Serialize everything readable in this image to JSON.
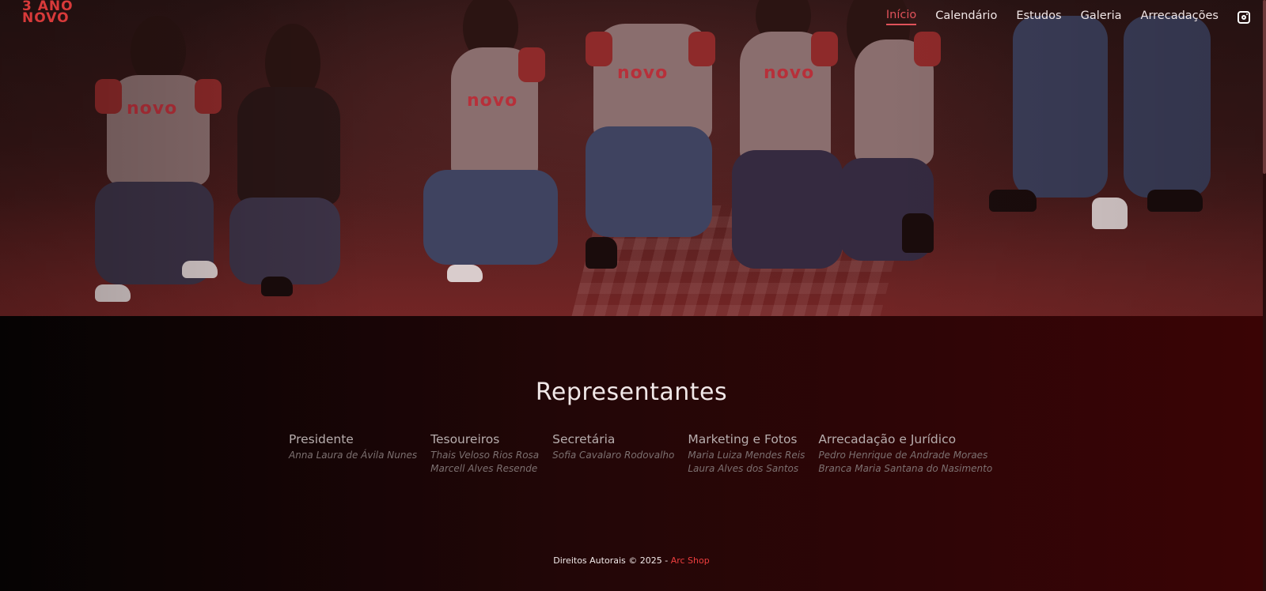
{
  "logo": {
    "line1": "3 ANO",
    "line2": "NOVO"
  },
  "nav": {
    "items": [
      {
        "label": "Início",
        "active": true
      },
      {
        "label": "Calendário",
        "active": false
      },
      {
        "label": "Estudos",
        "active": false
      },
      {
        "label": "Galeria",
        "active": false
      },
      {
        "label": "Arrecadações",
        "active": false
      }
    ],
    "social_icon": "instagram-icon"
  },
  "hero": {
    "shirt_print": "novo"
  },
  "representatives": {
    "title": "Representantes",
    "groups": [
      {
        "role": "Presidente",
        "names": [
          "Anna Laura de Ávila Nunes"
        ]
      },
      {
        "role": "Tesoureiros",
        "names": [
          "Thais Veloso Rios Rosa",
          "Marcell Alves Resende"
        ]
      },
      {
        "role": "Secretária",
        "names": [
          "Sofia Cavalaro Rodovalho"
        ]
      },
      {
        "role": "Marketing e Fotos",
        "names": [
          "Maria Luiza Mendes Reis",
          "Laura Alves dos Santos"
        ]
      },
      {
        "role": "Arrecadação e Jurídico",
        "names": [
          "Pedro Henrique de Andrade Moraes",
          "Branca Maria Santana do Nasimento"
        ]
      }
    ]
  },
  "footer": {
    "text": "Direitos Autorais © 2025 - ",
    "brand": "Arc Shop"
  },
  "colors": {
    "accent": "#e0525a",
    "brand_red": "#ee3e3e",
    "logo_red": "#d83a3a"
  }
}
